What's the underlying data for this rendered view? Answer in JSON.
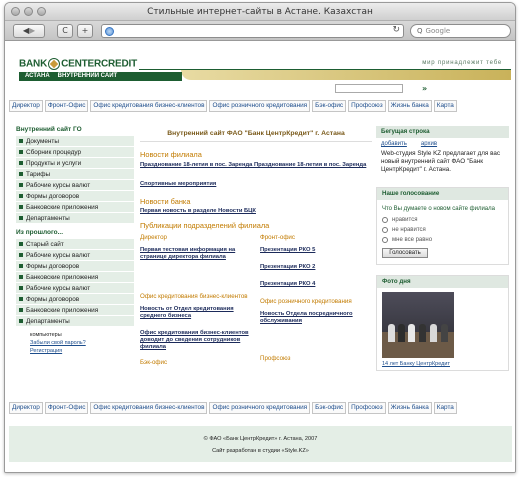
{
  "browser": {
    "window_title": "Стильные интернет-сайты в Астане. Казахстан",
    "search_placeholder": "Google",
    "back_icon": "◀",
    "forward_icon": "▶",
    "reload_icon": "C",
    "add_icon": "+",
    "url_reload_icon": "↻",
    "search_icon": "Q"
  },
  "header": {
    "logo_left": "BANK",
    "logo_right": "CENTERCREDIT",
    "logo_sub_left": "АСТАНА",
    "logo_sub_right": "ВНУТРЕННИЙ САЙТ",
    "tagline": "мир принадлежит тебе",
    "go_arrow": "»"
  },
  "menu": [
    "Директор",
    "Фронт-Офис",
    "Офис кредитования бизнес-клиентов",
    "Офис розничного кредитования",
    "Бэк-офис",
    "Профсоюз",
    "Жизнь банка",
    "Карта"
  ],
  "left": {
    "heading1": "Внутренний сайт ГО",
    "items1": [
      "Документы",
      "Сборник процедур",
      "Продукты и услуги",
      "Тарифы",
      "Рабочие курсы валют",
      "Формы договоров",
      "Банковские приложения",
      "Департаменты"
    ],
    "heading2": "Из прошлого...",
    "items2": [
      "Старый сайт",
      "Рабочие курсы валют",
      "Формы договоров",
      "Банковские приложения",
      "Рабочие курсы валют",
      "Формы договоров",
      "Банковские приложения",
      "Департаменты"
    ],
    "links": [
      "компьютеры",
      "Забыли свой пароль?",
      "Регистрация"
    ]
  },
  "main": {
    "title": "Внутренний сайт ФАО \"Банк ЦентрКредит\" г. Астана",
    "news_heading": "Новости филиала",
    "news_links": [
      "Празднование 18-летия в пос. Заренда Празднование 18-летия в пос. Заренда",
      "Спортивные мероприятия"
    ],
    "bank_news_heading": "Новости банка",
    "bank_news_link": "Первая новость в разделе Новости БЦК",
    "pubs_heading": "Публикации подразделений филиала",
    "sub": {
      "director": "Директор",
      "director_link": "Первая тестовая информация на странице директора филиала",
      "front": "Фронт-офис",
      "front_links": [
        "Презентация РКО 5",
        "Презентация РКО 2",
        "Презентация РКО 4"
      ],
      "business": "Офис кредитования бизнес-клиентов",
      "business_links": [
        "Новость от Отдел кредитования среднего бизнеса",
        "Офис кредитования бизнес-клиентов доводит до сведения сотрудников филиала"
      ],
      "retail": "Офис розничного кредитования",
      "retail_link": "Новость Отдела посредничного обслуживания",
      "back": "Бэк-офис",
      "union": "Профсоюз"
    }
  },
  "right": {
    "ticker_title": "Бегущая строка",
    "ticker_links": [
      "добавить",
      "архив"
    ],
    "ticker_text": "Web-студия Style KZ предлагает для вас новый внутренний сайт ФАО \"Банк ЦентрКредит\" г. Астана.",
    "poll_title": "Наше голосование",
    "poll_question": "Что Вы думаете о новом сайте филиала",
    "poll_options": [
      "нравится",
      "не нравится",
      "мне все равно"
    ],
    "vote_button": "Голосовать",
    "photo_title": "Фото дня",
    "photo_caption": "14 лет Банку ЦентрКредит"
  },
  "footer": {
    "copyright": "© ФАО «Банк ЦентрКредит» г. Астана, 2007",
    "studio": "Сайт разработан в студии «Style.KZ»"
  }
}
